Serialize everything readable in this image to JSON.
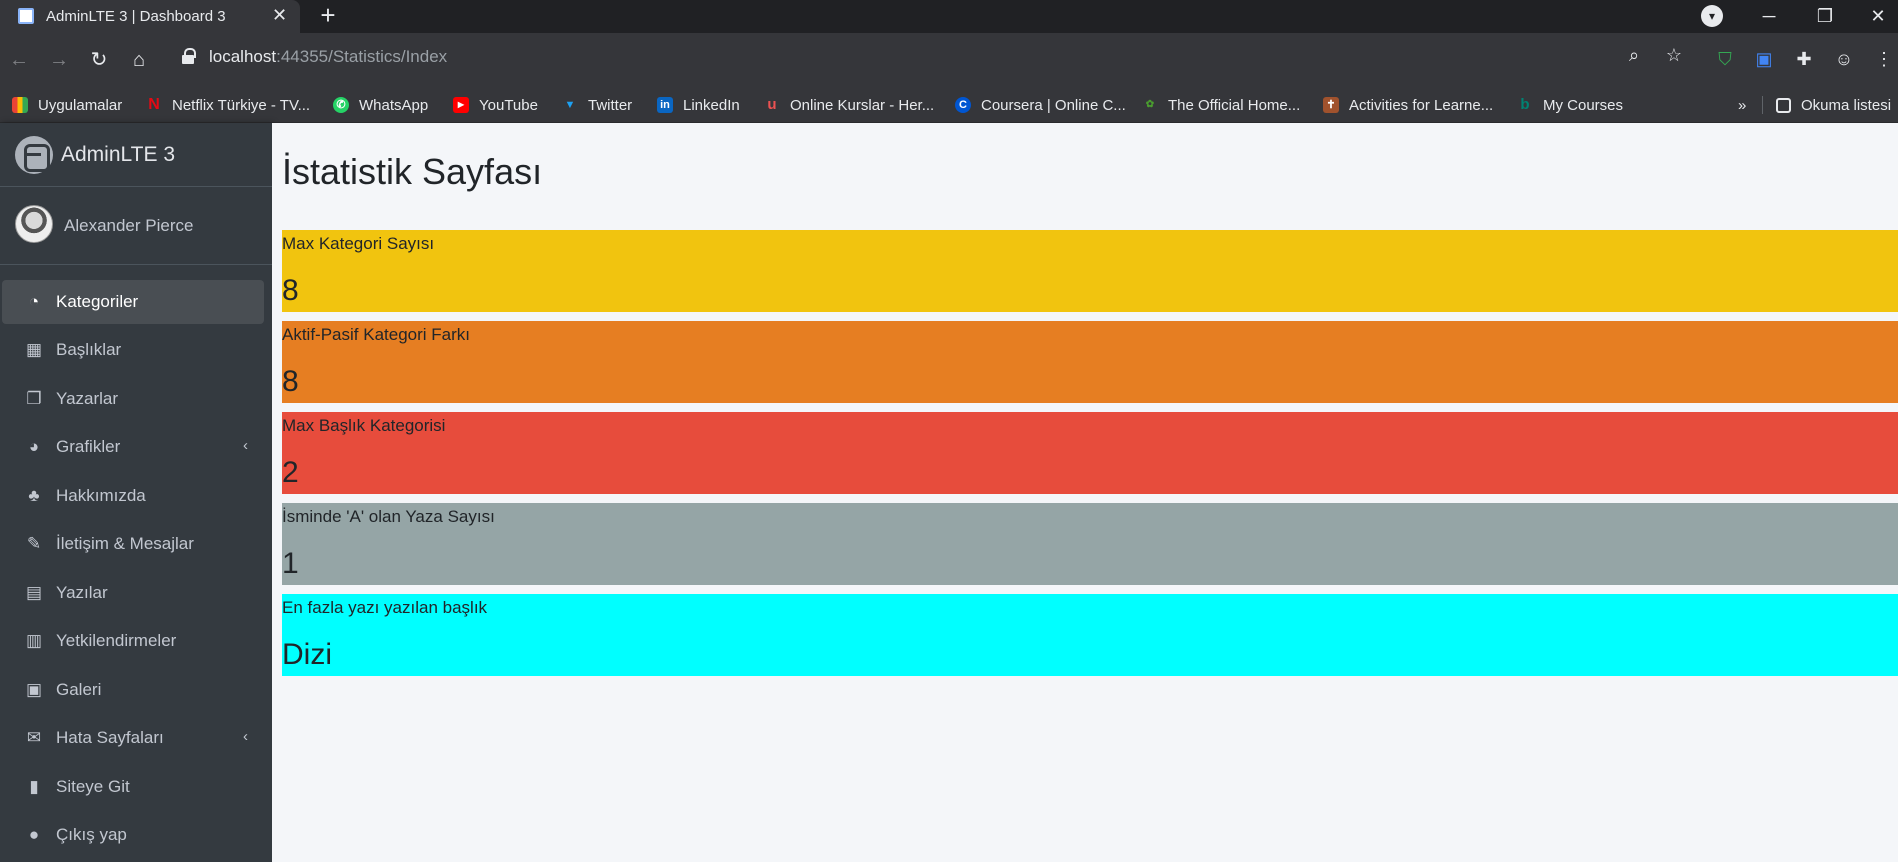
{
  "browser": {
    "tab_title": "AdminLTE 3 | Dashboard 3",
    "new_tab": "+",
    "url_host": "localhost",
    "url_rest": ":44355/Statistics/Index"
  },
  "bookmarks": [
    {
      "label": "Uygulamalar",
      "icon": "apps-grid-icon",
      "color": "#e8453c"
    },
    {
      "label": "Netflix Türkiye - TV...",
      "icon": "netflix-icon",
      "color": "#e50914"
    },
    {
      "label": "WhatsApp",
      "icon": "whatsapp-icon",
      "color": "#25d366"
    },
    {
      "label": "YouTube",
      "icon": "youtube-icon",
      "color": "#ff0000"
    },
    {
      "label": "Twitter",
      "icon": "twitter-icon",
      "color": "#1da1f2"
    },
    {
      "label": "LinkedIn",
      "icon": "linkedin-icon",
      "color": "#0a66c2"
    },
    {
      "label": "Online Kurslar - Her...",
      "icon": "udemy-icon",
      "color": "#ec5252"
    },
    {
      "label": "Coursera | Online C...",
      "icon": "coursera-icon",
      "color": "#0056d2"
    },
    {
      "label": "The Official Home...",
      "icon": "official-home-icon",
      "color": "#4a9d2f"
    },
    {
      "label": "Activities for Learne...",
      "icon": "shield-crest-icon",
      "color": "#b8860b"
    },
    {
      "label": "My Courses",
      "icon": "bing-icon",
      "color": "#008373"
    }
  ],
  "reading_list": "Okuma listesi",
  "more_bookmarks": "»",
  "sidebar": {
    "brand": "AdminLTE 3",
    "user": "Alexander Pierce",
    "items": [
      {
        "label": "Kategoriler",
        "icon": "tachometer-icon",
        "glyph": "◔",
        "active": true
      },
      {
        "label": "Başlıklar",
        "icon": "th-grid-icon",
        "glyph": "▦"
      },
      {
        "label": "Yazarlar",
        "icon": "copy-icon",
        "glyph": "❐"
      },
      {
        "label": "Grafikler",
        "icon": "chart-pie-icon",
        "glyph": "◕",
        "arrow": "‹"
      },
      {
        "label": "Hakkımızda",
        "icon": "tree-icon",
        "glyph": "♣"
      },
      {
        "label": "İletişim & Mesajlar",
        "icon": "edit-icon",
        "glyph": "✎"
      },
      {
        "label": "Yazılar",
        "icon": "table-icon",
        "glyph": "▤"
      },
      {
        "label": "Yetkilendirmeler",
        "icon": "calendar-icon",
        "glyph": "▥"
      },
      {
        "label": "Galeri",
        "icon": "image-icon",
        "glyph": "▣"
      },
      {
        "label": "Hata Sayfaları",
        "icon": "envelope-icon",
        "glyph": "✉",
        "arrow": "‹"
      },
      {
        "label": "Siteye Git",
        "icon": "book-icon",
        "glyph": "▮"
      },
      {
        "label": "Çıkış yap",
        "icon": "apple-icon",
        "glyph": "●"
      }
    ]
  },
  "main": {
    "title": "İstatistik Sayfası",
    "stats": [
      {
        "label": "Max Kategori Sayısı",
        "value": "8",
        "color": "#f1c40f"
      },
      {
        "label": "Aktif-Pasif Kategori Farkı",
        "value": "8",
        "color": "#e67e22"
      },
      {
        "label": "Max Başlık Kategorisi",
        "value": "2",
        "color": "#e74c3c"
      },
      {
        "label": "İsminde 'A' olan Yaza Sayısı",
        "value": "1",
        "color": "#95a5a6"
      },
      {
        "label": "En fazla yazı yazılan başlık",
        "value": "Dizi",
        "color": "#00ffff"
      }
    ]
  }
}
